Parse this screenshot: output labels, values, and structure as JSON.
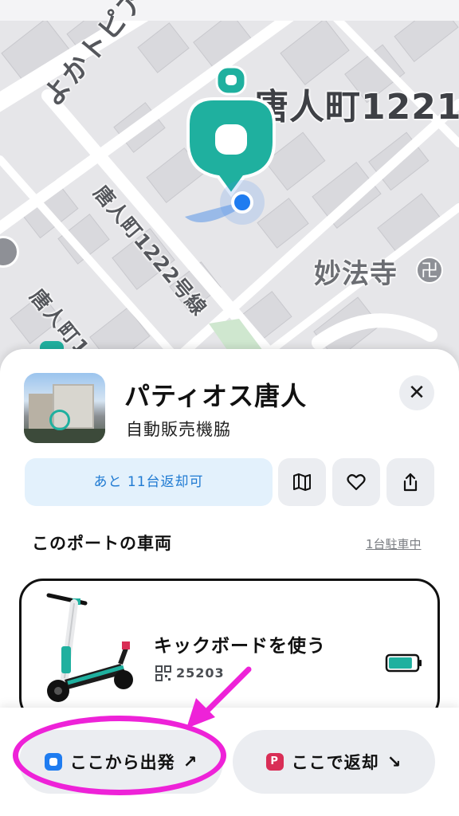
{
  "map": {
    "road_label_1": "よかトピア通",
    "address_label": "唐人町1221",
    "route_label": "唐人町1222号線",
    "partial_label": "唐人町1",
    "temple_label": "妙法寺",
    "temple_icon_glyph": "卍"
  },
  "port": {
    "title": "パティオス唐人",
    "subtitle": "自動販売機脇",
    "return_capacity": "あと 11台返却可",
    "close_glyph": "✕"
  },
  "vehicles_section": {
    "heading": "このポートの車両",
    "parked_link": "1台駐車中",
    "vehicle": {
      "label": "キックボードを使う",
      "id": "25203",
      "battery_level": 0.85
    }
  },
  "actions": {
    "start_label": "ここから出発",
    "start_arrow": "↗",
    "return_label": "ここで返却",
    "return_arrow": "↘",
    "return_badge": "P"
  },
  "colors": {
    "brand_teal": "#1fb09f",
    "user_blue": "#1f7cf0",
    "annotation_magenta": "#ee22d8",
    "return_badge_red": "#d92e56"
  }
}
